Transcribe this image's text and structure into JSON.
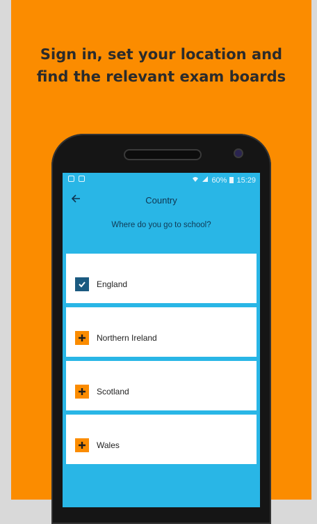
{
  "headline": {
    "line1": "Sign in, set your location and",
    "line2": "find the relevant exam boards"
  },
  "statusbar": {
    "battery": "60%",
    "time": "15:29"
  },
  "appbar": {
    "back_icon": "arrow-left-icon",
    "title": "Country"
  },
  "prompt": "Where do you go to school?",
  "countries": [
    {
      "label": "England",
      "selected": true
    },
    {
      "label": "Northern Ireland",
      "selected": false
    },
    {
      "label": "Scotland",
      "selected": false
    },
    {
      "label": "Wales",
      "selected": false
    }
  ],
  "colors": {
    "background": "#fb8c00",
    "screen": "#29b6e6",
    "checked": "#1b5a80",
    "unchecked": "#fb8c00"
  }
}
